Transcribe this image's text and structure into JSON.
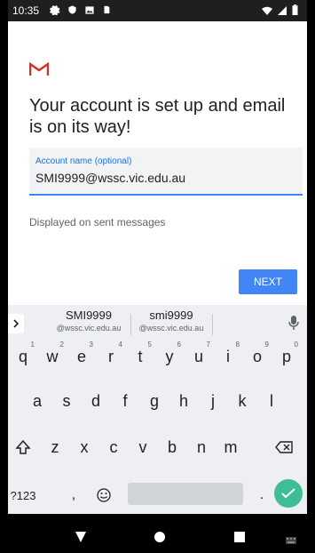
{
  "status_bar": {
    "time": "10:35",
    "left_icons": [
      "gear-icon",
      "shield-icon",
      "image-icon",
      "sd-card-icon"
    ],
    "right_icons": [
      "wifi-icon",
      "signal-icon",
      "battery-icon"
    ]
  },
  "app": {
    "logo": "gmail-m-icon",
    "headline": "Your account is set up and email is on its way!",
    "account_field": {
      "label": "Account name (optional)",
      "value": "SMI9999@wssc.vic.edu.au"
    },
    "helper_text": "Displayed on sent messages",
    "next_button": "NEXT"
  },
  "keyboard": {
    "suggestions": [
      {
        "main": "SMI9999",
        "sub": "@wssc.vic.edu.au"
      },
      {
        "main": "smi9999",
        "sub": "@wssc.vic.edu.au"
      }
    ],
    "row1": [
      {
        "k": "q",
        "n": "1"
      },
      {
        "k": "w",
        "n": "2"
      },
      {
        "k": "e",
        "n": "3"
      },
      {
        "k": "r",
        "n": "4"
      },
      {
        "k": "t",
        "n": "5"
      },
      {
        "k": "y",
        "n": "6"
      },
      {
        "k": "u",
        "n": "7"
      },
      {
        "k": "i",
        "n": "8"
      },
      {
        "k": "o",
        "n": "9"
      },
      {
        "k": "p",
        "n": "0"
      }
    ],
    "row2": [
      "a",
      "s",
      "d",
      "f",
      "g",
      "h",
      "j",
      "k",
      "l"
    ],
    "row3": [
      "z",
      "x",
      "c",
      "v",
      "b",
      "n",
      "m"
    ],
    "bottom": {
      "symbols": "?123",
      "comma": ",",
      "period": "."
    }
  },
  "colors": {
    "accent": "#4285f4",
    "enter": "#3dbe94",
    "gmail_red": "#d93025"
  }
}
